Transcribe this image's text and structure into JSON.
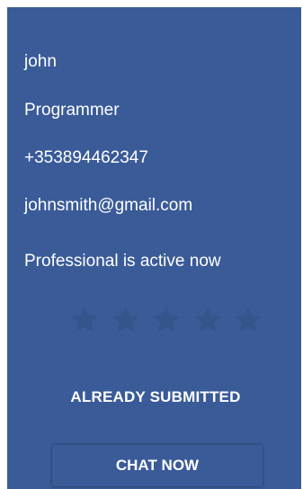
{
  "profile": {
    "name": "john",
    "profession": "Programmer",
    "phone": "+353894462347",
    "email": "johnsmith@gmail.com",
    "status": "Professional is active now"
  },
  "rating": {
    "max": 5,
    "value": 0,
    "star_icon": "star-icon",
    "empty_color": "#35548c"
  },
  "actions": {
    "submitted_label": "ALREADY SUBMITTED",
    "chat_label": "CHAT NOW"
  },
  "colors": {
    "card_background": "#3a5b98",
    "text": "#ffffff"
  }
}
